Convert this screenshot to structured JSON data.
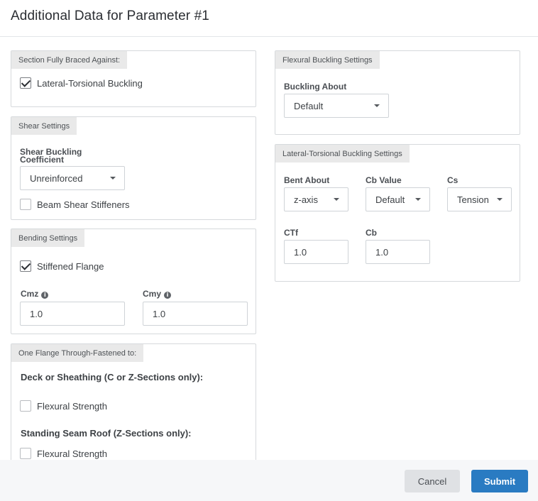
{
  "modal": {
    "title": "Additional Data for Parameter #1"
  },
  "braced": {
    "header": "Section Fully Braced Against:",
    "ltb_label": "Lateral-Torsional Buckling",
    "ltb_checked": true
  },
  "shear": {
    "header": "Shear Settings",
    "coef_label_1": "Shear Buckling",
    "coef_label_2": "Coefficient",
    "coef_value": "Unreinforced",
    "stiffeners_label": "Beam Shear Stiffeners",
    "stiffeners_checked": false
  },
  "bending": {
    "header": "Bending Settings",
    "stiffened_label": "Stiffened Flange",
    "stiffened_checked": true,
    "cmz_label": "Cmz",
    "cmz_value": "1.0",
    "cmy_label": "Cmy",
    "cmy_value": "1.0"
  },
  "flange": {
    "header": "One Flange Through-Fastened to:",
    "deck_heading": "Deck or Sheathing (C or Z-Sections only):",
    "deck_flexural_label": "Flexural Strength",
    "deck_flexural_checked": false,
    "seam_heading": "Standing Seam Roof (Z-Sections only):",
    "seam_flexural_label": "Flexural Strength",
    "seam_flexural_checked": false
  },
  "flexural": {
    "header": "Flexural Buckling Settings",
    "about_label": "Buckling About",
    "about_value": "Default"
  },
  "ltb_settings": {
    "header": "Lateral-Torsional Buckling Settings",
    "bent_about_label": "Bent About",
    "bent_about_value": "z-axis",
    "cb_value_label": "Cb Value",
    "cb_value_value": "Default",
    "cs_label": "Cs",
    "cs_value": "Tension",
    "ctf_label": "CTf",
    "ctf_value": "1.0",
    "cb_label": "Cb",
    "cb_value": "1.0"
  },
  "footer": {
    "cancel_label": "Cancel",
    "submit_label": "Submit"
  },
  "colors": {
    "accent": "#2a7bc2",
    "tag_bg": "#e9e9e9",
    "footer_bg": "#f6f7f9"
  },
  "icons": {
    "info": "info-circle-icon",
    "check": "checkmark-icon",
    "caret": "caret-down-icon"
  }
}
